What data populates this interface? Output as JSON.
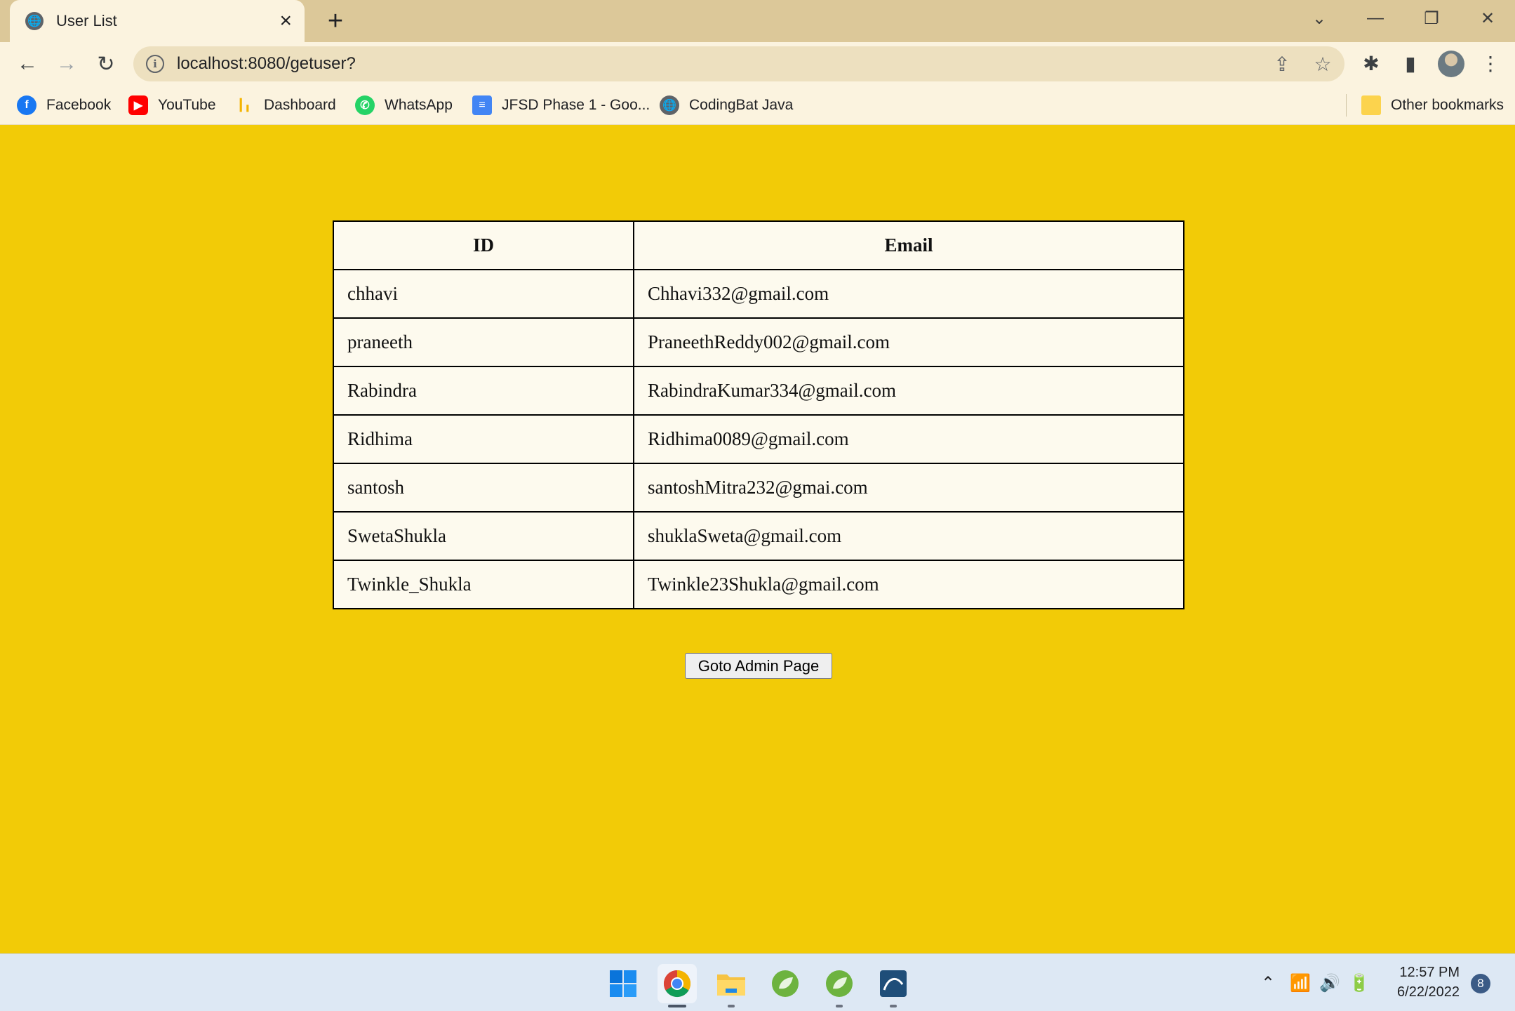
{
  "browser": {
    "tab_title": "User List",
    "url": "localhost:8080/getuser?",
    "bookmarks": [
      {
        "label": "Facebook",
        "icon": "facebook-icon"
      },
      {
        "label": "YouTube",
        "icon": "youtube-icon"
      },
      {
        "label": "Dashboard",
        "icon": "dashboard-icon"
      },
      {
        "label": "WhatsApp",
        "icon": "whatsapp-icon"
      },
      {
        "label": "JFSD Phase 1 - Goo...",
        "icon": "google-docs-icon"
      },
      {
        "label": "CodingBat Java",
        "icon": "globe-icon"
      }
    ],
    "other_bookmarks": "Other bookmarks"
  },
  "table": {
    "headers": [
      "ID",
      "Email"
    ],
    "rows": [
      [
        "chhavi",
        "Chhavi332@gmail.com"
      ],
      [
        "praneeth",
        "PraneethReddy002@gmail.com"
      ],
      [
        "Rabindra",
        "RabindraKumar334@gmail.com"
      ],
      [
        "Ridhima",
        "Ridhima0089@gmail.com"
      ],
      [
        "santosh",
        "santoshMitra232@gmai.com"
      ],
      [
        "SwetaShukla",
        "shuklaSweta@gmail.com"
      ],
      [
        "Twinkle_Shukla",
        "Twinkle23Shukla@gmail.com"
      ]
    ]
  },
  "button": {
    "label": "Goto Admin Page"
  },
  "taskbar": {
    "time": "12:57 PM",
    "date": "6/22/2022",
    "notification_count": "8"
  },
  "colors": {
    "page_background": "#f2cb07",
    "table_background": "#fdfaee",
    "browser_frame": "#dcc899",
    "toolbar": "#fbf3df"
  }
}
